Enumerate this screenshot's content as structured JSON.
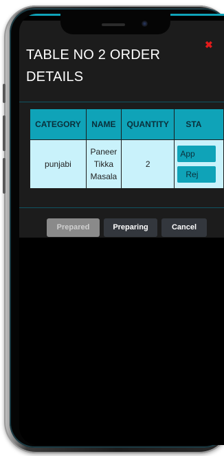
{
  "modal": {
    "title": "TABLE NO 2 ORDER DETAILS",
    "close_symbol": "✖",
    "close_color": "#e21b1b"
  },
  "table": {
    "headers": [
      "CATEGORY",
      "NAME",
      "QUANTITY",
      "STA"
    ],
    "rows": [
      {
        "category": "punjabi",
        "name_lines": [
          "Paneer",
          "Tikka",
          "Masala"
        ],
        "quantity": "2",
        "status_buttons": [
          "App",
          "Rej"
        ]
      }
    ]
  },
  "actions": {
    "prepared": "Prepared",
    "preparing": "Preparing",
    "cancel": "Cancel"
  },
  "colors": {
    "accent": "#0fa3b8",
    "cell_bg": "#c9f2fb",
    "modal_bg": "#1c1c1c",
    "disabled_button": "#8a8a8a",
    "dark_button": "#33373d"
  },
  "icons": {
    "close": "close-icon"
  }
}
